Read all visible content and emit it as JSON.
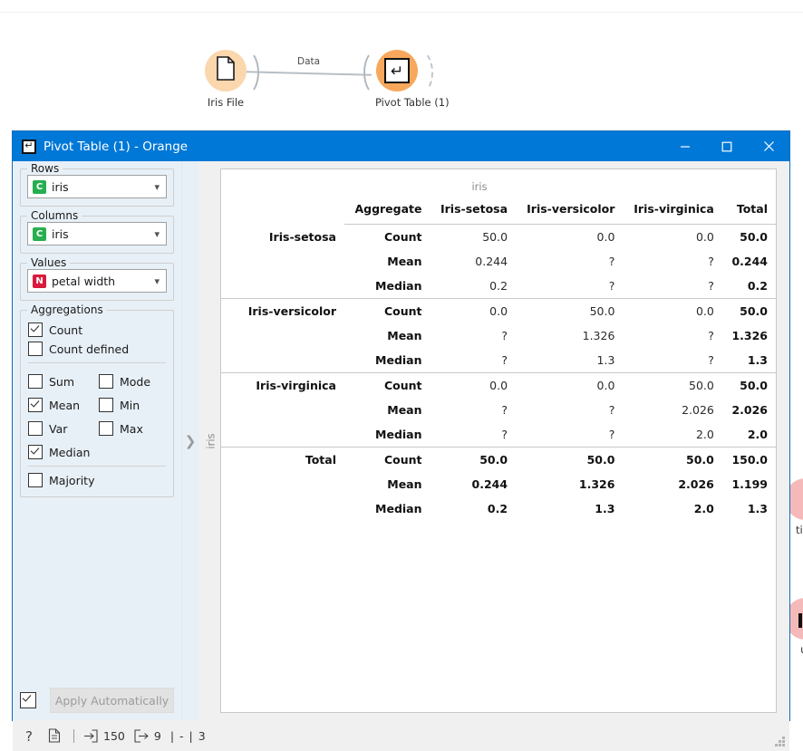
{
  "canvas": {
    "nodes": [
      {
        "label": "Iris File",
        "icon": "file-icon"
      },
      {
        "label": "Pivot Table (1)",
        "icon": "pivot-table-icon"
      }
    ],
    "link_label": "Data",
    "edge_widgets": [
      {
        "label_fragment": "tion",
        "icon": "circle-icon"
      },
      {
        "label_fragment": "ut",
        "icon": "bar-chart-icon"
      }
    ]
  },
  "window": {
    "title": "Pivot Table (1) - Orange",
    "icon": "pivot-table-icon",
    "controls": {
      "minimize": "minimize-icon",
      "maximize": "maximize-icon",
      "close": "close-icon"
    },
    "accent_color": "#0078d7"
  },
  "sidebar": {
    "rows": {
      "title": "Rows",
      "value": "iris",
      "badge": "C",
      "badge_color": "#27ae4f"
    },
    "columns": {
      "title": "Columns",
      "value": "iris",
      "badge": "C",
      "badge_color": "#27ae4f"
    },
    "values": {
      "title": "Values",
      "value": "petal width",
      "badge": "N",
      "badge_color": "#d81b3c"
    },
    "aggregations": {
      "title": "Aggregations",
      "primary": [
        {
          "label": "Count",
          "checked": true
        },
        {
          "label": "Count defined",
          "checked": false
        }
      ],
      "grid": [
        {
          "label": "Sum",
          "checked": false
        },
        {
          "label": "Mode",
          "checked": false
        },
        {
          "label": "Mean",
          "checked": true
        },
        {
          "label": "Min",
          "checked": false
        },
        {
          "label": "Var",
          "checked": false
        },
        {
          "label": "Max",
          "checked": false
        }
      ],
      "median": {
        "label": "Median",
        "checked": true
      },
      "majority": {
        "label": "Majority",
        "checked": false
      }
    },
    "apply": {
      "label": "Apply Automatically",
      "checked": true
    },
    "splitter_icon": "chevron-right-icon"
  },
  "table": {
    "column_variable_label": "iris",
    "row_variable_label": "iris",
    "headers": [
      "",
      "Aggregate",
      "Iris-setosa",
      "Iris-versicolor",
      "Iris-virginica",
      "Total"
    ],
    "groups": [
      {
        "name": "Iris-setosa",
        "rows": [
          {
            "aggregate": "Count",
            "values": [
              "50.0",
              "0.0",
              "0.0"
            ],
            "total": "50.0"
          },
          {
            "aggregate": "Mean",
            "values": [
              "0.244",
              "?",
              "?"
            ],
            "total": "0.244"
          },
          {
            "aggregate": "Median",
            "values": [
              "0.2",
              "?",
              "?"
            ],
            "total": "0.2"
          }
        ]
      },
      {
        "name": "Iris-versicolor",
        "rows": [
          {
            "aggregate": "Count",
            "values": [
              "0.0",
              "50.0",
              "0.0"
            ],
            "total": "50.0"
          },
          {
            "aggregate": "Mean",
            "values": [
              "?",
              "1.326",
              "?"
            ],
            "total": "1.326"
          },
          {
            "aggregate": "Median",
            "values": [
              "?",
              "1.3",
              "?"
            ],
            "total": "1.3"
          }
        ]
      },
      {
        "name": "Iris-virginica",
        "rows": [
          {
            "aggregate": "Count",
            "values": [
              "0.0",
              "0.0",
              "50.0"
            ],
            "total": "50.0"
          },
          {
            "aggregate": "Mean",
            "values": [
              "?",
              "?",
              "2.026"
            ],
            "total": "2.026"
          },
          {
            "aggregate": "Median",
            "values": [
              "?",
              "?",
              "2.0"
            ],
            "total": "2.0"
          }
        ]
      },
      {
        "name": "Total",
        "is_total": true,
        "rows": [
          {
            "aggregate": "Count",
            "values": [
              "50.0",
              "50.0",
              "50.0"
            ],
            "total": "150.0"
          },
          {
            "aggregate": "Mean",
            "values": [
              "0.244",
              "1.326",
              "2.026"
            ],
            "total": "1.199"
          },
          {
            "aggregate": "Median",
            "values": [
              "0.2",
              "1.3",
              "2.0"
            ],
            "total": "1.3"
          }
        ]
      }
    ]
  },
  "statusbar": {
    "help_icon": "question-mark-icon",
    "report_icon": "document-icon",
    "input_icon": "arrow-into-box-icon",
    "input_count": "150",
    "output_icon": "arrow-out-of-box-icon",
    "output_count": "9",
    "separator1": "|",
    "dash": "-",
    "separator2": "|",
    "extra_count": "3"
  }
}
